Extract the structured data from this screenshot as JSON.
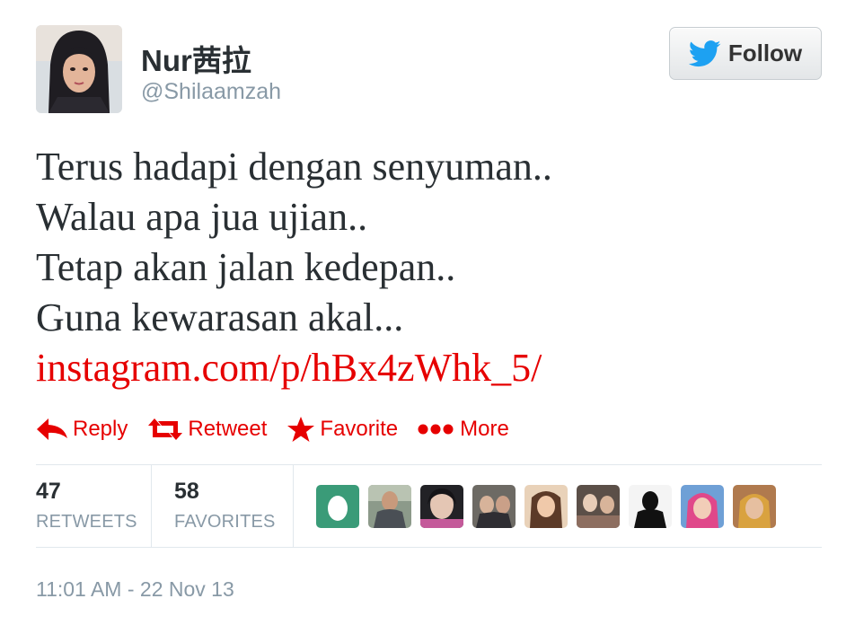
{
  "user": {
    "display_name": "Nur茜拉",
    "handle": "@Shilaamzah",
    "avatar_icon": "profile-photo"
  },
  "follow_button": {
    "label": "Follow",
    "icon": "twitter-bird-icon",
    "icon_color": "#1da1f2"
  },
  "tweet": {
    "lines": [
      "Terus hadapi dengan senyuman..",
      "Walau apa jua ujian..",
      "Tetap akan jalan kedepan..",
      "Guna kewarasan akal..."
    ],
    "link": "instagram.com/p/hBx4zWhk_5/"
  },
  "actions": [
    {
      "label": "Reply",
      "icon": "reply-arrow-icon"
    },
    {
      "label": "Retweet",
      "icon": "retweet-icon"
    },
    {
      "label": "Favorite",
      "icon": "star-icon"
    },
    {
      "label": "More",
      "icon": "more-dots-icon"
    }
  ],
  "stats": {
    "retweets": {
      "count": "47",
      "label": "RETWEETS"
    },
    "favorites": {
      "count": "58",
      "label": "FAVORITES"
    }
  },
  "favoriters_count_shown": 9,
  "timestamp": "11:01 AM - 22 Nov 13",
  "colors": {
    "accent": "#e60000",
    "muted": "#8899a6",
    "text": "#292f33",
    "divider": "#e1e8ed"
  }
}
